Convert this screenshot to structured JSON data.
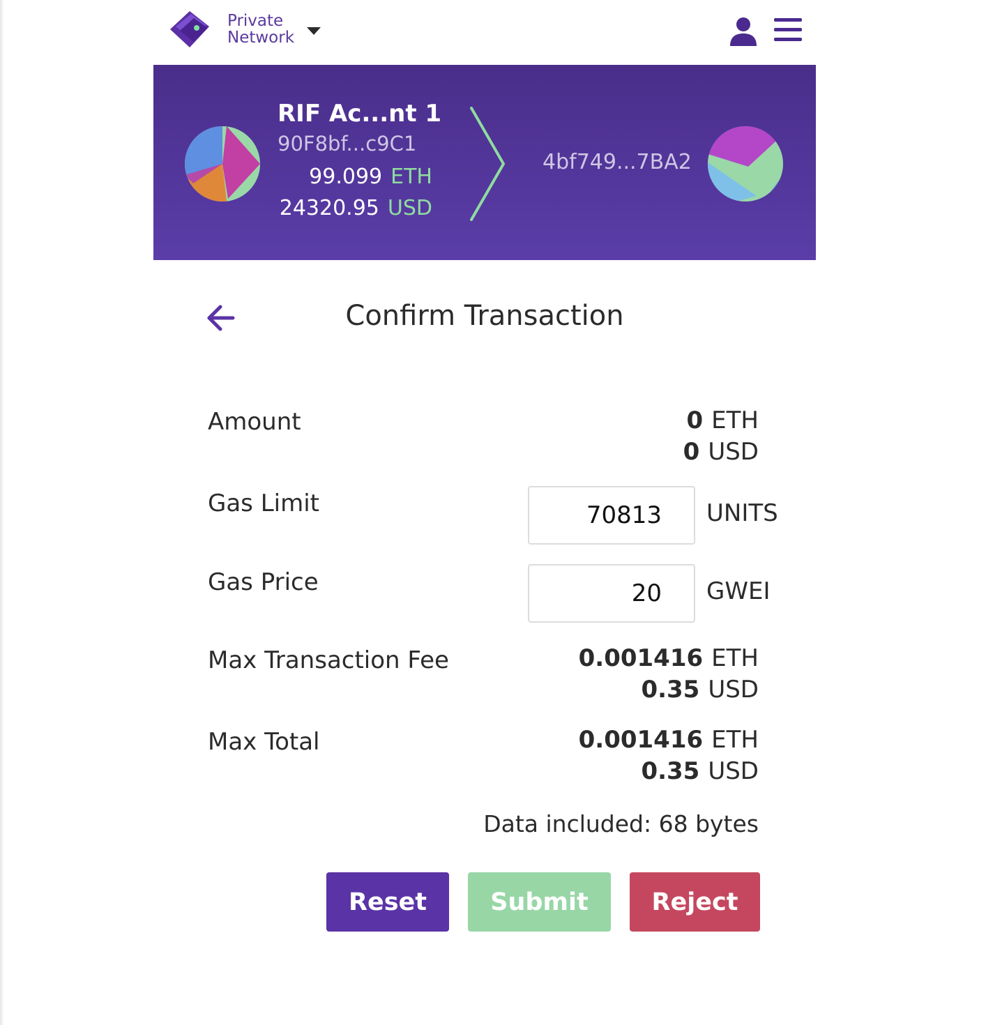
{
  "network": {
    "label_line1": "Private",
    "label_line2": "Network"
  },
  "from_account": {
    "name": "RIF Ac...nt 1",
    "address": "90F8bf...c9C1",
    "balance_eth": "99.099",
    "eth_unit": "ETH",
    "balance_usd": "24320.95",
    "usd_unit": "USD"
  },
  "to_account": {
    "address": "4bf749...7BA2"
  },
  "page": {
    "title": "Confirm Transaction"
  },
  "amount": {
    "label": "Amount",
    "eth_value": "0",
    "eth_unit": "ETH",
    "usd_value": "0",
    "usd_unit": "USD"
  },
  "gas_limit": {
    "label": "Gas Limit",
    "value": "70813",
    "unit": "UNITS"
  },
  "gas_price": {
    "label": "Gas Price",
    "value": "20",
    "unit": "GWEI"
  },
  "max_fee": {
    "label": "Max Transaction Fee",
    "eth_value": "0.001416",
    "eth_unit": "ETH",
    "usd_value": "0.35",
    "usd_unit": "USD"
  },
  "max_total": {
    "label": "Max Total",
    "eth_value": "0.001416",
    "eth_unit": "ETH",
    "usd_value": "0.35",
    "usd_unit": "USD"
  },
  "data_included": "Data included: 68 bytes",
  "buttons": {
    "reset": "Reset",
    "submit": "Submit",
    "reject": "Reject"
  },
  "colors": {
    "header_top": "#4a2e8a",
    "header_bottom": "#5a3da8",
    "accent_green": "#8fdca0",
    "reset": "#5a33a6",
    "submit": "#98d6a6",
    "reject": "#c5475f"
  }
}
